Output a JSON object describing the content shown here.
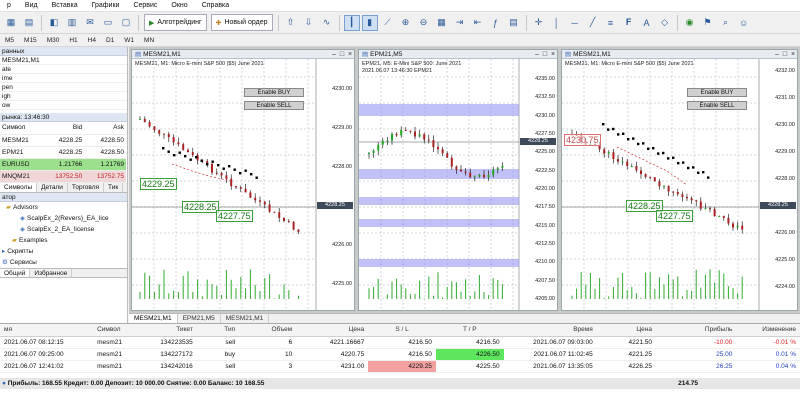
{
  "menu": [
    "р",
    "Вид",
    "Вставка",
    "Графики",
    "Сервис",
    "Окно",
    "Справка"
  ],
  "toolbar": {
    "algo_label": "Алготрейдинг",
    "new_order_label": "Новый ордер"
  },
  "timeframes": [
    "M5",
    "M15",
    "M30",
    "H1",
    "H4",
    "D1",
    "W1",
    "MN"
  ],
  "left": {
    "data_window_title": "ранных",
    "data_window_symbol": "MESM21,M1",
    "data_rows": [
      "ate",
      "ime",
      "pen",
      "igh",
      "ow"
    ],
    "market_watch_title": "рынка: 13:46:30",
    "market_watch_headers": [
      "Символ",
      "Bid",
      "Ask"
    ],
    "market_watch_rows": [
      {
        "symbol": "MESM21",
        "bid": "4228.25",
        "ask": "4228.50"
      },
      {
        "symbol": "EPM21",
        "bid": "4228.25",
        "ask": "4228.50"
      },
      {
        "symbol": "EURUSD",
        "bid": "1.21766",
        "ask": "1.21769"
      },
      {
        "symbol": "MNQM21",
        "bid": "13752.50",
        "ask": "13752.75"
      }
    ],
    "mw_tabs": [
      "Символы",
      "Детали",
      "Торговля",
      "Тик"
    ],
    "navigator_title": "атор",
    "nav_items": [
      "Advisors",
      "ScalpEx_2(Revers)_EA_lice",
      "ScalpEx_2_EA_license",
      "Examples",
      "Скрипты",
      "Сервисы"
    ],
    "nav_tabs": [
      "Общий",
      "Избранное"
    ]
  },
  "charts": [
    {
      "title": "MESM21,M1",
      "info": "MESM21, M1:  Micro E-mini S&P 500 ($5) June 2021",
      "info2": "",
      "buy_label": "Enable BUY",
      "sell_label": "Enable SELL",
      "price_tag": "4228.25",
      "ticks": [
        "4230.00",
        "4229.00",
        "4228.00",
        "4227.00",
        "4226.00",
        "4225.00"
      ],
      "labels": [
        "4229.25",
        "4228.25",
        "4227.75"
      ]
    },
    {
      "title": "EPM21,M5",
      "info": "EPM21, M5:  E-Mini S&P 500: June 2021",
      "info2": "2021.06.07 13:46:30   EPM21",
      "price_tag": "4228.25",
      "ticks": [
        "4235.00",
        "4232.50",
        "4230.00",
        "4227.50",
        "4225.00",
        "4222.50",
        "4220.00",
        "4217.50",
        "4215.00",
        "4212.50",
        "4210.00",
        "4207.50",
        "4205.00"
      ]
    },
    {
      "title": "MESM21,M1",
      "info": "MESM21, M1:  Micro E-mini S&P 500 ($5) June 2021",
      "info2": "",
      "buy_label": "Enable BUY",
      "sell_label": "Enable SELL",
      "price_tag": "4228.25",
      "ticks": [
        "4232.00",
        "4231.00",
        "4230.00",
        "4229.00",
        "4228.00",
        "4227.00",
        "4226.00",
        "4225.00",
        "4224.00"
      ],
      "labels": [
        "4230.75",
        "4228.25",
        "4227.75"
      ]
    }
  ],
  "chart_tabs": [
    "MESM21,M1",
    "EPM21,M5",
    "MESM21,M1"
  ],
  "terminal": {
    "headers": [
      "мя",
      "Символ",
      "Тикет",
      "Тип",
      "Объем",
      "Цена",
      "S / L",
      "T / P",
      "Время",
      "Цена",
      "Прибыль",
      "Изменение"
    ],
    "rows": [
      {
        "time": "2021.06.07 08:12:15",
        "symbol": "mesm21",
        "ticket": "134223535",
        "type": "sell",
        "volume": "6",
        "price": "4221.16667",
        "sl": "4216.50",
        "tp": "4216.50",
        "time2": "2021.06.07 09:03:00",
        "cur": "4221.50",
        "profit": "-10.00",
        "change": "-0.01 %"
      },
      {
        "time": "2021.06.07 09:25:00",
        "symbol": "mesm21",
        "ticket": "134227172",
        "type": "buy",
        "volume": "10",
        "price": "4220.75",
        "sl": "4216.50",
        "tp": "4226.50",
        "time2": "2021.06.07 11:02:45",
        "cur": "4221.25",
        "profit": "25.00",
        "change": "0.01 %"
      },
      {
        "time": "2021.06.07 12:41:02",
        "symbol": "mesm21",
        "ticket": "134242016",
        "type": "sell",
        "volume": "3",
        "price": "4231.00",
        "sl": "4229.25",
        "tp": "4225.50",
        "time2": "2021.06.07 13:35:05",
        "cur": "4226.25",
        "profit": "26.25",
        "change": "0.04 %"
      }
    ],
    "summary": "Прибыль: 168.55  Кредит: 0.00  Депозит: 10 000.00  Снятие: 0.00  Баланс: 10 168.55",
    "summary_total": "214.75"
  },
  "colors": {
    "tp_hit": "#5ee65e",
    "sl_hit": "#f2a0a0",
    "profit_neg": "#e02020",
    "profit_pos": "#2040c0",
    "band": "#8d8ff0"
  }
}
